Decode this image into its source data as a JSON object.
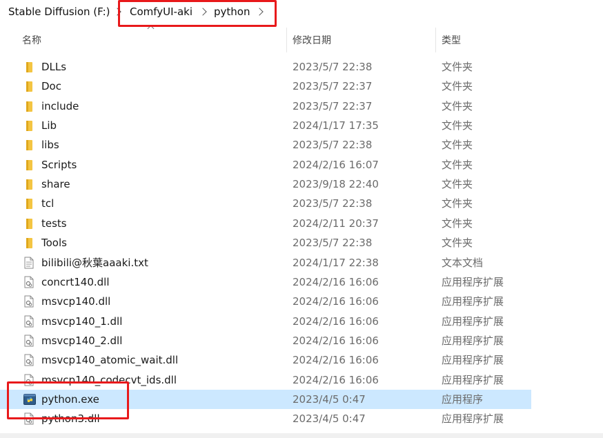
{
  "breadcrumb": {
    "items": [
      "Stable Diffusion (F:)",
      "ComfyUI-aki",
      "python"
    ]
  },
  "columns": {
    "name": "名称",
    "date": "修改日期",
    "type": "类型"
  },
  "files": [
    {
      "name": "DLLs",
      "date": "2023/5/7 22:38",
      "type": "文件夹",
      "icon": "folder-icon"
    },
    {
      "name": "Doc",
      "date": "2023/5/7 22:37",
      "type": "文件夹",
      "icon": "folder-icon"
    },
    {
      "name": "include",
      "date": "2023/5/7 22:37",
      "type": "文件夹",
      "icon": "folder-icon"
    },
    {
      "name": "Lib",
      "date": "2024/1/17 17:35",
      "type": "文件夹",
      "icon": "folder-icon"
    },
    {
      "name": "libs",
      "date": "2023/5/7 22:38",
      "type": "文件夹",
      "icon": "folder-icon"
    },
    {
      "name": "Scripts",
      "date": "2024/2/16 16:07",
      "type": "文件夹",
      "icon": "folder-icon"
    },
    {
      "name": "share",
      "date": "2023/9/18 22:40",
      "type": "文件夹",
      "icon": "folder-icon"
    },
    {
      "name": "tcl",
      "date": "2023/5/7 22:38",
      "type": "文件夹",
      "icon": "folder-icon"
    },
    {
      "name": "tests",
      "date": "2024/2/11 20:37",
      "type": "文件夹",
      "icon": "folder-icon"
    },
    {
      "name": "Tools",
      "date": "2023/5/7 22:38",
      "type": "文件夹",
      "icon": "folder-icon"
    },
    {
      "name": "bilibili@秋葉aaaki.txt",
      "date": "2024/1/17 22:38",
      "type": "文本文档",
      "icon": "text-file-icon"
    },
    {
      "name": "concrt140.dll",
      "date": "2024/2/16 16:06",
      "type": "应用程序扩展",
      "icon": "dll-file-icon"
    },
    {
      "name": "msvcp140.dll",
      "date": "2024/2/16 16:06",
      "type": "应用程序扩展",
      "icon": "dll-file-icon"
    },
    {
      "name": "msvcp140_1.dll",
      "date": "2024/2/16 16:06",
      "type": "应用程序扩展",
      "icon": "dll-file-icon"
    },
    {
      "name": "msvcp140_2.dll",
      "date": "2024/2/16 16:06",
      "type": "应用程序扩展",
      "icon": "dll-file-icon"
    },
    {
      "name": "msvcp140_atomic_wait.dll",
      "date": "2024/2/16 16:06",
      "type": "应用程序扩展",
      "icon": "dll-file-icon"
    },
    {
      "name": "msvcp140_codecvt_ids.dll",
      "date": "2024/2/16 16:06",
      "type": "应用程序扩展",
      "icon": "dll-file-icon"
    },
    {
      "name": "python.exe",
      "date": "2023/4/5 0:47",
      "type": "应用程序",
      "icon": "python-exe-icon",
      "selected": true
    },
    {
      "name": "python3.dll",
      "date": "2023/4/5 0:47",
      "type": "应用程序扩展",
      "icon": "dll-file-icon"
    }
  ],
  "colors": {
    "selection": "#cce8ff",
    "highlight": "#e8191b",
    "folder": "#f4c542"
  }
}
